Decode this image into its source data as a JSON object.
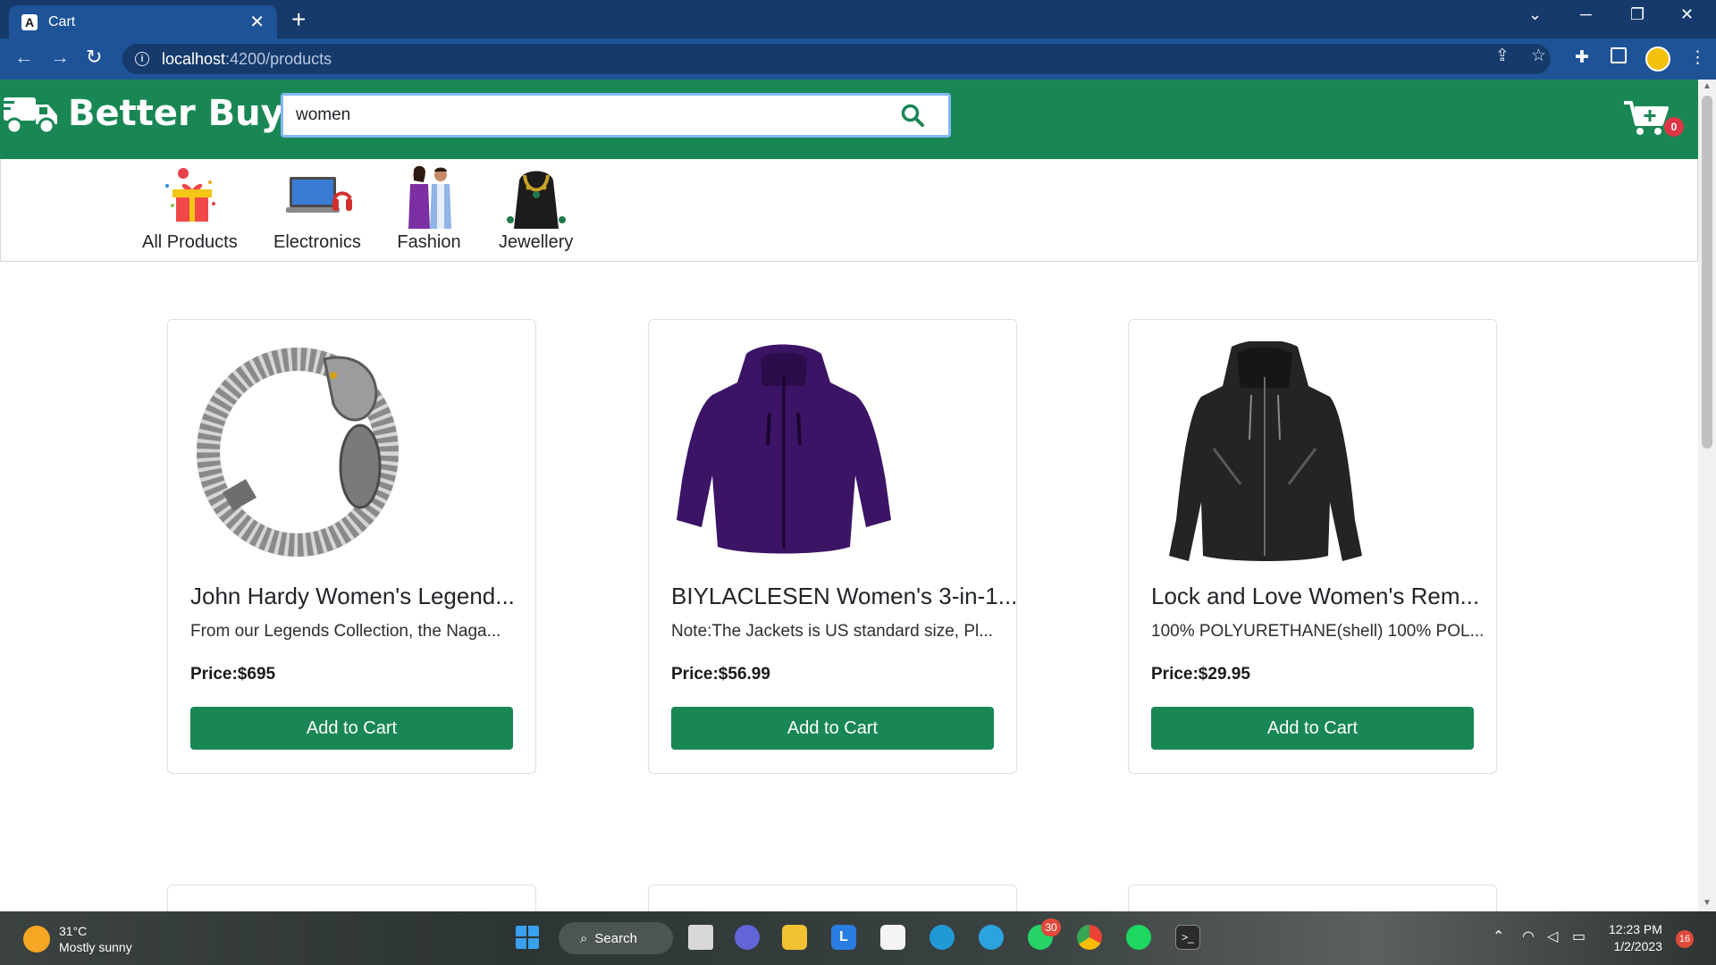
{
  "browser": {
    "tab_title": "Cart",
    "tab_favicon": "A",
    "url_host": "localhost",
    "url_path": ":4200/products"
  },
  "header": {
    "brand_name": "Better Buys!",
    "search_value": "women",
    "cart_count": "0"
  },
  "categories": [
    {
      "label": "All Products",
      "icon": "gift-icon"
    },
    {
      "label": "Electronics",
      "icon": "laptop-icon"
    },
    {
      "label": "Fashion",
      "icon": "fashion-models-icon"
    },
    {
      "label": "Jewellery",
      "icon": "necklace-icon"
    }
  ],
  "products": [
    {
      "title": "John Hardy Women's Legend...",
      "description": "From our Legends Collection, the Naga...",
      "price": "Price:$695",
      "button": "Add to Cart",
      "image": "silver-dragon-bracelet"
    },
    {
      "title": "BIYLACLESEN Women's 3-in-1...",
      "description": "Note:The Jackets is US standard size, Pl...",
      "price": "Price:$56.99",
      "button": "Add to Cart",
      "image": "purple-jacket"
    },
    {
      "title": "Lock and Love Women's Rem...",
      "description": "100% POLYURETHANE(shell) 100% POL...",
      "price": "Price:$29.95",
      "button": "Add to Cart",
      "image": "black-leather-jacket"
    }
  ],
  "taskbar": {
    "temperature": "31°C",
    "weather": "Mostly sunny",
    "search_label": "Search",
    "whatsapp_badge": "30",
    "time": "12:23 PM",
    "date": "1/2/2023",
    "notifications": "16"
  },
  "colors": {
    "primary_green": "#198754",
    "chrome_blue": "#1e5398",
    "badge_red": "#dc3545"
  }
}
